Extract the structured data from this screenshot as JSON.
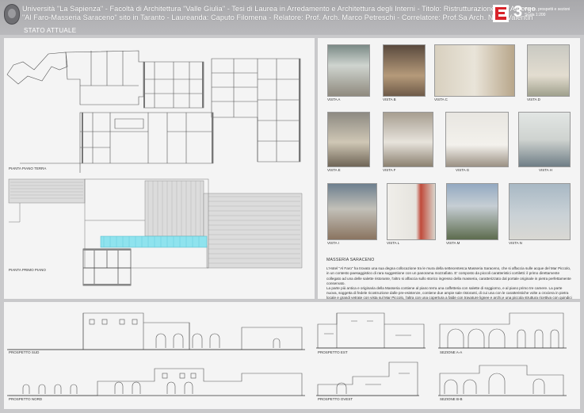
{
  "header": {
    "line1": "Università \"La Sapienza\" - Facoltà di Architettura \"Valle Giulia\" - Tesi di Laurea in Arredamento e Architettura degli Interni - Titolo: Ristrutturazione dell'Albergo",
    "line2": "\"Al Faro-Masseria Saraceno\" sito in Taranto - Laureanda: Caputo Filomena - Relatore: Prof. Arch. Marco Petreschi - Correlatore: Prof.Sa Arch. Nilda Valentin",
    "table_number": "3",
    "table_sub1": "Piante, prospetti e sezioni",
    "table_sub2": "Scala 1:200",
    "section": "STATO ATTUALE"
  },
  "plans": {
    "ground_label": "PIANTA PIANO TERRA",
    "first_label": "PIANTA PRIMO PIANO"
  },
  "photos": {
    "a": "VISTA A",
    "b": "VISTA B",
    "c": "VISTA C",
    "d": "VISTA D",
    "e": "VISTA E",
    "f": "VISTA F",
    "g": "VISTA G",
    "h": "VISTA H",
    "i": "VISTA I",
    "l": "VISTA L",
    "m": "VISTA M",
    "n": "VISTA N"
  },
  "description": {
    "title": "MASSERIA SARACENO",
    "p1": "L'Hotel \"Al Faro\" ha trovato una sua degna collocazione tra le mura della settecentesca Masseria Saraceno, che si affaccia sulle acque del Mar Piccolo, in un contesto paesaggistico di rara suggestione con un panorama mozzafiato. E' composto da piccoli caratteristici cortiletti: il primo direttamente collegato ad una delle salette ristorante, l'altro si affaccia sullo storico ingresso della masseria, caratterizzato dal portale originale in pietra perfettamente conservato.",
    "p2": "La parte più antica e originaria della Masseria contiene al piano terra una caffetteria con salette di soggiorno, e al piano primo tre camere. La parte nuova, soggetta di fedele ricostruzione dalle pre-esistenze, contiene due ampie sale ristoranti, di cui una con le caratteristiche volte a crociera in pietra locale e grandi vetrate con vista sul Mar Piccolo, l'altra con una copertura a falde con travature lignee e archi,e una piccola struttura ricettiva con quindici camere"
  },
  "elevations": {
    "sud": "PROSPETTO SUD",
    "nord": "PROSPETTO NORD",
    "est": "PROSPETTO EST",
    "ovest": "PROSPETTO OVEST",
    "sez_aa": "SEZIONE A-A",
    "sez_bb": "SEZIONE B-B"
  },
  "colors": {
    "background": "#c9c9cb",
    "panel": "#f4f4f4",
    "logo_red": "#d8232a",
    "glass_cyan": "#8fe3ee"
  }
}
